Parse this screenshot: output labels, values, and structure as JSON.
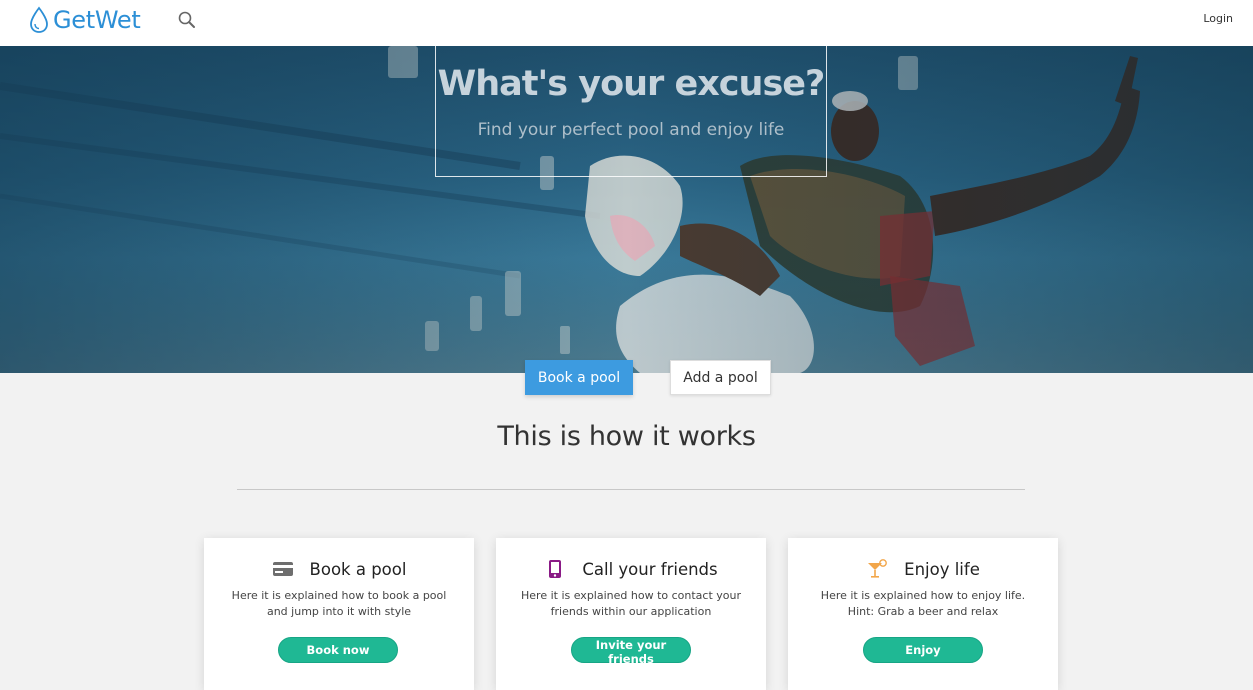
{
  "navbar": {
    "brand": "GetWet",
    "search_icon": "search-icon",
    "login_label": "Login",
    "brand_color": "#2c8fd6"
  },
  "hero": {
    "title": "What's your excuse?",
    "subtitle": "Find your perfect pool and enjoy life"
  },
  "cta": {
    "book_label": "Book a pool",
    "add_label": "Add a pool",
    "book_color": "#3d9be0"
  },
  "how_it_works": {
    "title": "This is how it works",
    "cards": [
      {
        "icon": "credit-card-icon",
        "title": "Book a pool",
        "description": "Here it is explained how to book a pool and jump into it with style",
        "button": "Book now"
      },
      {
        "icon": "phone-icon",
        "title": "Call your friends",
        "description": "Here it is explained how to contact your friends within our application",
        "button": "Invite your friends"
      },
      {
        "icon": "cocktail-icon",
        "title": "Enjoy life",
        "description": "Here it is explained how to enjoy life. Hint: Grab a beer and relax",
        "button": "Enjoy"
      }
    ],
    "button_color": "#1fb894"
  }
}
